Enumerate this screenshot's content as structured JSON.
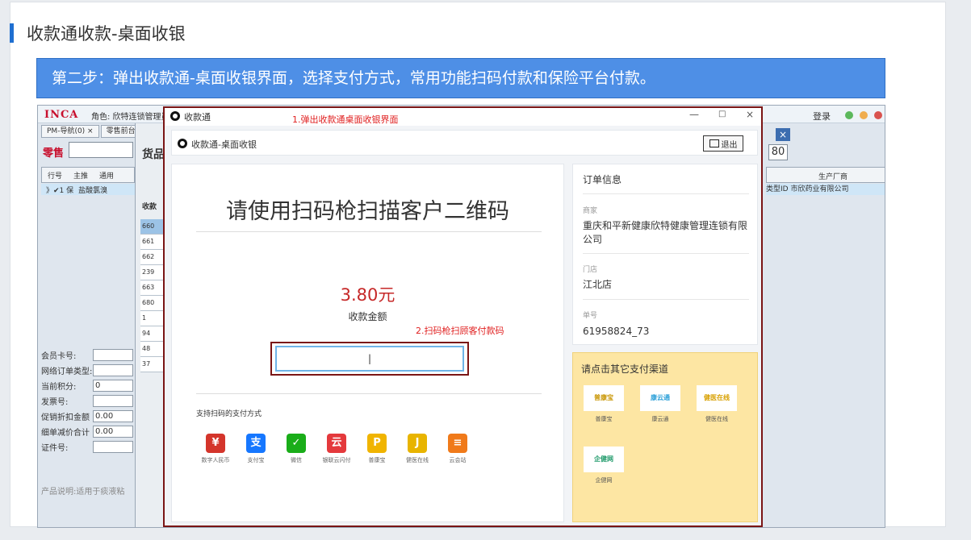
{
  "section": {
    "title": "收款通收款-桌面收银"
  },
  "step": {
    "text": "第二步：弹出收款通-桌面收银界面，选择支付方式，常用功能扫码付款和保险平台付款。"
  },
  "erp": {
    "brand": "INCA",
    "role": "角色: 欣特连锁管理员",
    "login": "登录",
    "tabs": [
      "PM-导航(0) ×",
      "零售前台"
    ],
    "retail_label": "零售",
    "grid_headers": [
      "行号",
      "主推",
      "通用"
    ],
    "grid_row": [
      "》✔1 保",
      "盐酸氯溴"
    ],
    "mid_title": "货品",
    "mid_header": "收款",
    "mid_list": [
      "660",
      "661",
      "662",
      "239",
      "663",
      "680",
      "1",
      "94",
      "48",
      "37"
    ],
    "right_value": "80",
    "right_header": "生产厂商",
    "right_row": "类型ID 市欣药业有限公司",
    "fields": [
      {
        "label": "会员卡号:",
        "value": ""
      },
      {
        "label": "网络订单类型:",
        "value": ""
      },
      {
        "label": "当前积分:",
        "value": "0"
      },
      {
        "label": "发票号:",
        "value": ""
      },
      {
        "label": "促销折扣金额",
        "value": "0.00"
      },
      {
        "label": "细单减价合计",
        "value": "0.00"
      },
      {
        "label": "证件号:",
        "value": ""
      }
    ],
    "desc": "产品说明:适用于痰液粘"
  },
  "modal": {
    "title": "收款通",
    "annot1": "1.弹出收款通桌面收银界面",
    "subtitle": "收款通-桌面收银",
    "exit_label": "退出",
    "scan_title": "请使用扫码枪扫描客户二维码",
    "amount": "3.80元",
    "amount_label": "收款金额",
    "annot2": "2.扫码枪扫顾客付款码",
    "scan_cursor": "|",
    "support_label": "支持扫码的支付方式",
    "pay_methods": [
      {
        "name": "数字人民币",
        "glyph": "¥",
        "color": "#d4352b"
      },
      {
        "name": "支付宝",
        "glyph": "支",
        "color": "#1677ff"
      },
      {
        "name": "微信",
        "glyph": "✓",
        "color": "#1aad19"
      },
      {
        "name": "银联云闪付",
        "glyph": "云",
        "color": "#e4393c"
      },
      {
        "name": "普康宝",
        "glyph": "P",
        "color": "#f0b400"
      },
      {
        "name": "健医在线",
        "glyph": "J",
        "color": "#e8b400"
      },
      {
        "name": "云会站",
        "glyph": "≡",
        "color": "#f07a1a"
      }
    ],
    "order": {
      "title": "订单信息",
      "merchant_label": "商家",
      "merchant": "重庆和平新健康欣特健康管理连锁有限公司",
      "store_label": "门店",
      "store": "江北店",
      "order_no_label": "单号",
      "order_no": "61958824_73"
    },
    "channels": {
      "title": "请点击其它支付渠道",
      "items": [
        {
          "name": "普康宝",
          "tile": "普康宝"
        },
        {
          "name": "康云通",
          "tile": "康云通"
        },
        {
          "name": "健医在线",
          "tile": "健医在线"
        },
        {
          "name": "企健网",
          "tile": "企健网"
        }
      ]
    }
  },
  "colors": {
    "accent": "#4e8fe6",
    "annot": "#e02020",
    "amount": "#c62828",
    "frame": "#7a1515",
    "channel_bg": "#fde6a3"
  }
}
